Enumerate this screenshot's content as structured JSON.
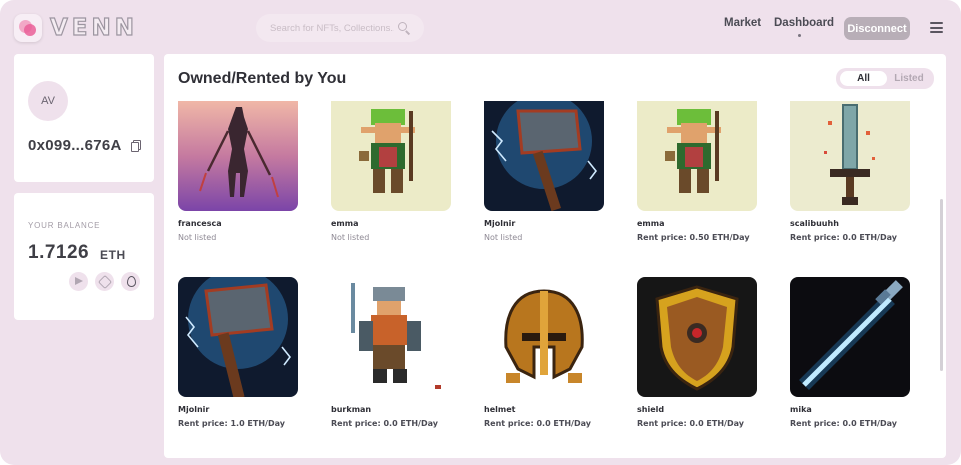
{
  "header": {
    "logo_text": "VENN",
    "search_placeholder": "Search for NFTs, Collections...",
    "nav": {
      "market": "Market",
      "dashboard": "Dashboard"
    },
    "disconnect": "Disconnect"
  },
  "profile": {
    "avatar_initials": "AV",
    "address": "0x099...676A"
  },
  "balance": {
    "label": "YOUR BALANCE",
    "value": "1.7126",
    "unit": "ETH"
  },
  "main": {
    "title": "Owned/Rented by You",
    "filter_all": "All",
    "filter_listed": "Listed"
  },
  "nfts": [
    {
      "name": "francesca",
      "status": "Not listed",
      "art": "warrior"
    },
    {
      "name": "emma",
      "status": "Not listed",
      "art": "elf"
    },
    {
      "name": "Mjolnir",
      "status": "Not listed",
      "art": "hammer"
    },
    {
      "name": "emma",
      "status": "Rent price:  0.50 ETH/Day",
      "art": "elf"
    },
    {
      "name": "scalibuuhh",
      "status": "Rent price:  0.0 ETH/Day",
      "art": "sword"
    },
    {
      "name": "Mjolnir",
      "status": "Rent price:  1.0 ETH/Day",
      "art": "hammer"
    },
    {
      "name": "burkman",
      "status": "Rent price:  0.0 ETH/Day",
      "art": "dwarf"
    },
    {
      "name": "helmet",
      "status": "Rent price:  0.0 ETH/Day",
      "art": "helmet"
    },
    {
      "name": "shield",
      "status": "Rent price:  0.0 ETH/Day",
      "art": "shield"
    },
    {
      "name": "mika",
      "status": "Rent price:  0.0 ETH/Day",
      "art": "lightsaber"
    }
  ]
}
